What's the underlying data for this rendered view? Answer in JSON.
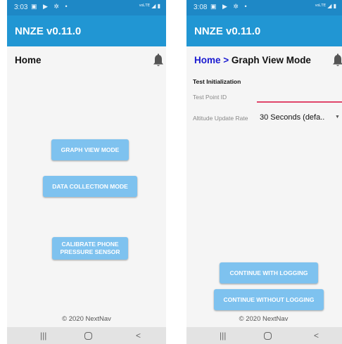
{
  "left": {
    "status": {
      "time": "3:03",
      "icons": "▣ ▶ ✲ •",
      "right_icons": "ᵛᵒᴸᵀᴱ ◢ ▮"
    },
    "app_title": "NNZE v0.11.0",
    "page_title": "Home",
    "buttons": {
      "graph_view": "GRAPH VIEW MODE",
      "data_collection": "DATA COLLECTION MODE",
      "calibrate_line1": "CALIBRATE PHONE",
      "calibrate_line2": "PRESSURE SENSOR"
    },
    "copyright": "© 2020 NextNav",
    "nav": {
      "recents": "|||",
      "back": "<"
    }
  },
  "right": {
    "status": {
      "time": "3:08",
      "icons": "▣ ▶ ✲ •",
      "right_icons": "ᵛᵒᴸᵀᴱ ◢ ▮"
    },
    "app_title": "NNZE v0.11.0",
    "breadcrumb": {
      "home": "Home >",
      "current": "Graph View Mode"
    },
    "section_title": "Test Initialization",
    "test_point": {
      "label": "Test Point ID",
      "value": ""
    },
    "altitude": {
      "label": "Altitude Update Rate",
      "value": "30 Seconds (defa.."
    },
    "buttons": {
      "continue_logging": "CONTINUE WITH LOGGING",
      "continue_without": "CONTINUE WITHOUT LOGGING"
    },
    "copyright": "© 2020 NextNav",
    "nav": {
      "recents": "|||",
      "back": "<"
    }
  },
  "colors": {
    "status_bar": "#1e88c6",
    "app_bar": "#2196d3",
    "button": "#7ec2ef",
    "breadcrumb_link": "#1a1ad0",
    "field_underline": "#e0456a"
  },
  "icons": [
    "bell-icon",
    "recents-icon",
    "home-icon",
    "back-icon"
  ]
}
